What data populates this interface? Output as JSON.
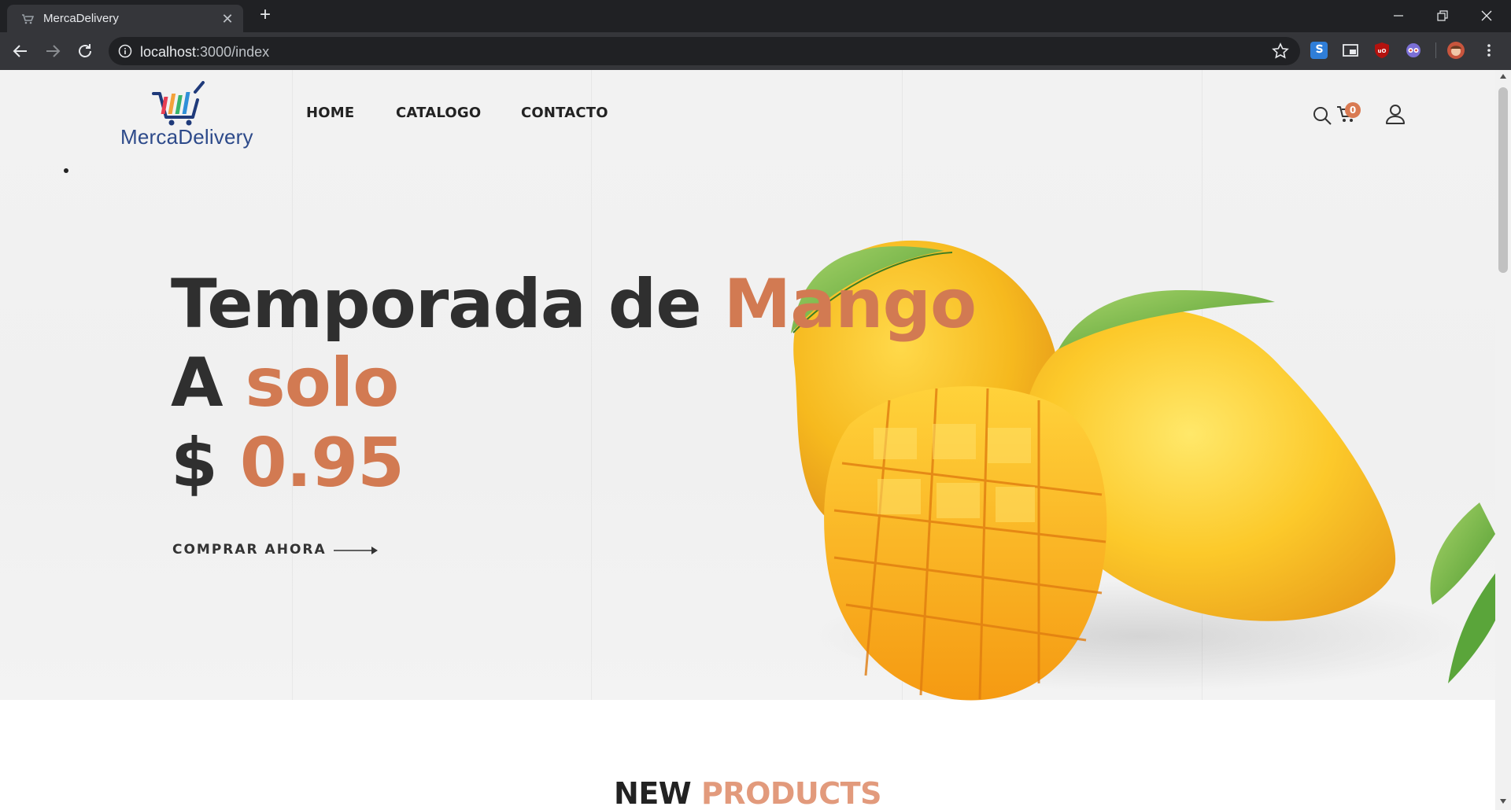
{
  "browser": {
    "tab_title": "MercaDelivery",
    "tab_close": "✕",
    "new_tab": "+",
    "url_host": "localhost",
    "url_path": ":3000/index"
  },
  "site": {
    "logo_text": "MercaDelivery",
    "nav": {
      "home": "HOME",
      "catalog": "CATALOGO",
      "contact": "CONTACTO"
    },
    "cart_count": "0"
  },
  "hero": {
    "line1_a": "Temporada de ",
    "line1_b": "Mango",
    "line2_a": "A ",
    "line2_b": "solo",
    "line3_a": "$ ",
    "line3_b": "0.95",
    "cta_label": "COMPRAR AHORA"
  },
  "section": {
    "title_a": "NEW ",
    "title_b": "PRODUCTS"
  },
  "colors": {
    "accent": "#d27a52",
    "brand_blue": "#2d4a8a",
    "section_accent": "#e29a7c"
  }
}
